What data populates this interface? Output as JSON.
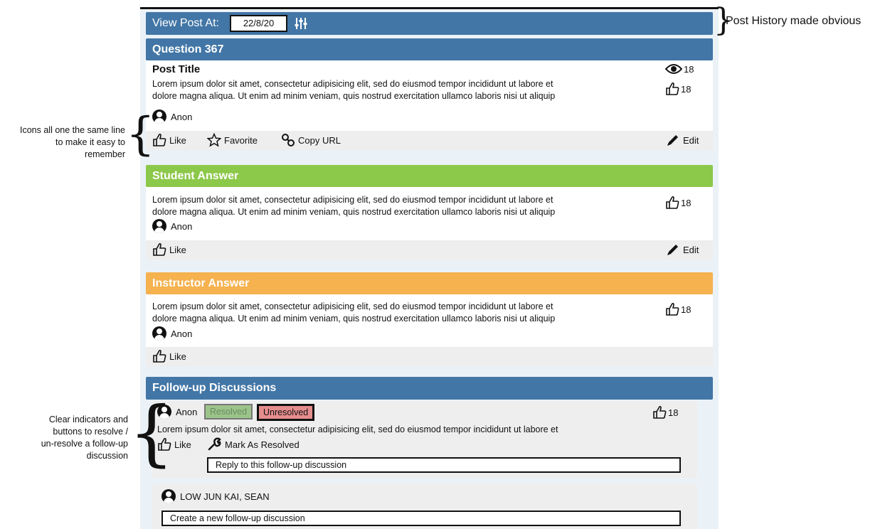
{
  "header": {
    "view_label": "View Post At:",
    "date_value": "22/8/20"
  },
  "question": {
    "bar_title": "Question 367",
    "post_title": "Post Title",
    "body_line1": "Lorem ipsum dolor sit amet, consectetur adipisicing elit, sed do eiusmod tempor incididunt ut labore et",
    "body_line2": "dolore magna aliqua. Ut enim ad minim veniam, quis nostrud exercitation ullamco laboris nisi ut aliquip",
    "views": "18",
    "likes": "18",
    "author": "Anon",
    "actions": {
      "like": "Like",
      "favorite": "Favorite",
      "copy_url": "Copy URL",
      "edit": "Edit"
    }
  },
  "student_answer": {
    "bar_title": "Student Answer",
    "body_line1": "Lorem ipsum dolor sit amet, consectetur adipisicing elit, sed do eiusmod tempor incididunt ut labore et",
    "body_line2": "dolore magna aliqua. Ut enim ad minim veniam, quis nostrud exercitation ullamco laboris nisi ut aliquip",
    "likes": "18",
    "author": "Anon",
    "actions": {
      "like": "Like",
      "edit": "Edit"
    }
  },
  "instructor_answer": {
    "bar_title": "Instructor Answer",
    "body_line1": "Lorem ipsum dolor sit amet, consectetur adipisicing elit, sed do eiusmod tempor incididunt ut labore et",
    "body_line2": "dolore magna aliqua. Ut enim ad minim veniam, quis nostrud exercitation ullamco laboris nisi ut aliquip",
    "likes": "18",
    "author": "Anon",
    "actions": {
      "like": "Like"
    }
  },
  "followups": {
    "bar_title": "Follow-up Discussions",
    "item": {
      "author": "Anon",
      "resolved_label": "Resolved",
      "unresolved_label": "Unresolved",
      "body": "Lorem ipsum dolor sit amet, consectetur adipisicing elit, sed do eiusmod tempor incididunt ut labore et",
      "likes": "18",
      "like_label": "Like",
      "mark_resolved_label": "Mark As Resolved",
      "reply_placeholder": "Reply to this follow-up discussion"
    },
    "new": {
      "author": "LOW JUN KAI, SEAN",
      "placeholder": "Create a new follow-up discussion"
    }
  },
  "annotations": {
    "history": "Post History made obvious",
    "icons_line1": "Icons all one the same line",
    "icons_line2": "to make it easy to",
    "icons_line3": "remember",
    "resolve_line1": "Clear indicators and",
    "resolve_line2": "buttons to resolve /",
    "resolve_line3": "un-resolve a follow-up",
    "resolve_line4": "discussion"
  }
}
